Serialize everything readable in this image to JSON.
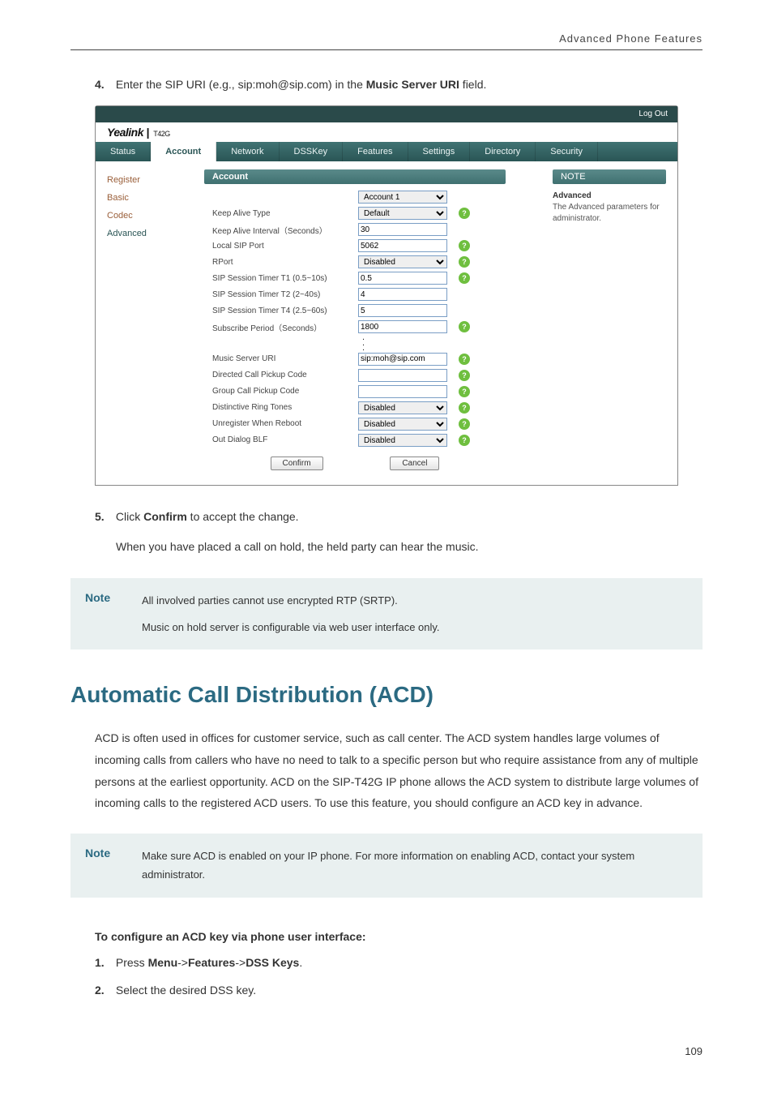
{
  "header": {
    "title": "Advanced Phone Features"
  },
  "step4": {
    "num": "4.",
    "prefix": "Enter the SIP URI (e.g., sip:moh@sip.com) in the ",
    "bold": "Music Server URI",
    "suffix": " field."
  },
  "screenshot": {
    "logout": "Log Out",
    "brand": "Yealink",
    "brand_model": "T42G",
    "tabs": [
      "Status",
      "Account",
      "Network",
      "DSSKey",
      "Features",
      "Settings",
      "Directory",
      "Security"
    ],
    "active_tab_index": 1,
    "side_items": [
      "Register",
      "Basic",
      "Codec",
      "Advanced"
    ],
    "side_active_index": 3,
    "form_title": "Account",
    "rows": [
      {
        "label": "",
        "value": "Account 1",
        "type": "select",
        "help": false
      },
      {
        "label": "Keep Alive Type",
        "value": "Default",
        "type": "select",
        "help": true
      },
      {
        "label": "Keep Alive Interval（Seconds）",
        "value": "30",
        "type": "input",
        "help": false
      },
      {
        "label": "Local SIP Port",
        "value": "5062",
        "type": "input",
        "help": true
      },
      {
        "label": "RPort",
        "value": "Disabled",
        "type": "select",
        "help": true
      },
      {
        "label": "SIP Session Timer T1 (0.5~10s)",
        "value": "0.5",
        "type": "input",
        "help": true
      },
      {
        "label": "SIP Session Timer T2 (2~40s)",
        "value": "4",
        "type": "input",
        "help": false
      },
      {
        "label": "SIP Session Timer T4 (2.5~60s)",
        "value": "5",
        "type": "input",
        "help": false
      },
      {
        "label": "Subscribe Period（Seconds）",
        "value": "1800",
        "type": "input",
        "help": true
      }
    ],
    "rows2": [
      {
        "label": "Music Server URI",
        "value": "sip:moh@sip.com",
        "type": "input",
        "help": true
      },
      {
        "label": "Directed Call Pickup Code",
        "value": "",
        "type": "input",
        "help": true
      },
      {
        "label": "Group Call Pickup Code",
        "value": "",
        "type": "input",
        "help": true
      },
      {
        "label": "Distinctive Ring Tones",
        "value": "Disabled",
        "type": "select",
        "help": true
      },
      {
        "label": "Unregister When Reboot",
        "value": "Disabled",
        "type": "select",
        "help": true
      },
      {
        "label": "Out Dialog BLF",
        "value": "Disabled",
        "type": "select",
        "help": true
      }
    ],
    "confirm": "Confirm",
    "cancel": "Cancel",
    "note_title": "NOTE",
    "note_head": "Advanced",
    "note_body": "The Advanced parameters for administrator."
  },
  "step5": {
    "num": "5.",
    "prefix": "Click ",
    "bold": "Confirm",
    "suffix": " to accept the change."
  },
  "follow": "When you have placed a call on hold, the held party can hear the music.",
  "note1": {
    "label": "Note",
    "line1": "All involved parties cannot use encrypted RTP (SRTP).",
    "line2": "Music on hold server is configurable via web user interface only."
  },
  "section_title": "Automatic Call Distribution (ACD)",
  "para1": "ACD is often used in offices for customer service, such as call center. The ACD system handles large volumes of incoming calls from callers who have no need to talk to a specific person but who require assistance from any of multiple persons at the earliest opportunity. ACD on the SIP-T42G IP phone allows the ACD system to distribute large volumes of incoming calls to the registered ACD users. To use this feature, you should configure an ACD key in advance.",
  "note2": {
    "label": "Note",
    "line1": "Make sure ACD is enabled on your IP phone. For more information on enabling ACD, contact your system administrator."
  },
  "sub_heading": "To configure an ACD key via phone user interface:",
  "sub_steps": [
    {
      "num": "1.",
      "pre": "Press ",
      "b1": "Menu",
      "m1": "->",
      "b2": "Features",
      "m2": "->",
      "b3": "DSS Keys",
      "suf": "."
    },
    {
      "num": "2.",
      "text": "Select the desired DSS key."
    }
  ],
  "page_num": "109"
}
